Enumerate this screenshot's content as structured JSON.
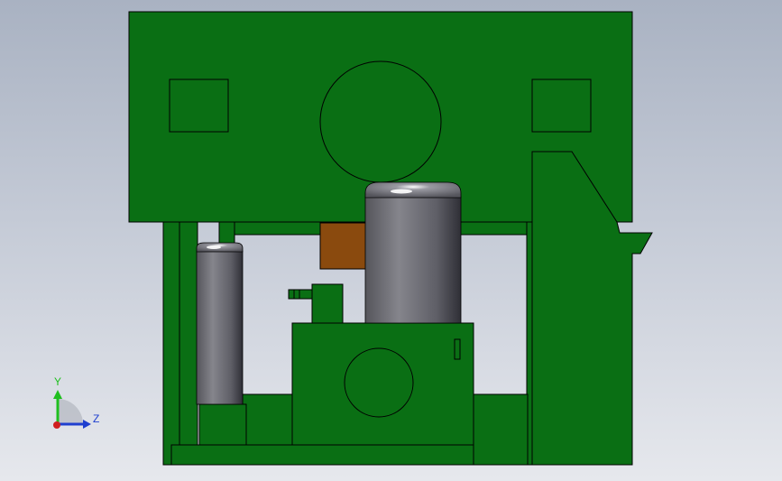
{
  "viewport": {
    "background_top": "#a9b2c2",
    "background_bottom": "#e6e8ed"
  },
  "model": {
    "body_color": "#0a6f14",
    "edge_color": "#000000",
    "bracket_color": "#8a4a0e",
    "cylinder_color": "#6e6e74"
  },
  "triad": {
    "y_label": "Y",
    "z_label": "Z",
    "y_color": "#1fbf1f",
    "z_color": "#1f3fcf",
    "x_color": "#cf1f1f"
  }
}
